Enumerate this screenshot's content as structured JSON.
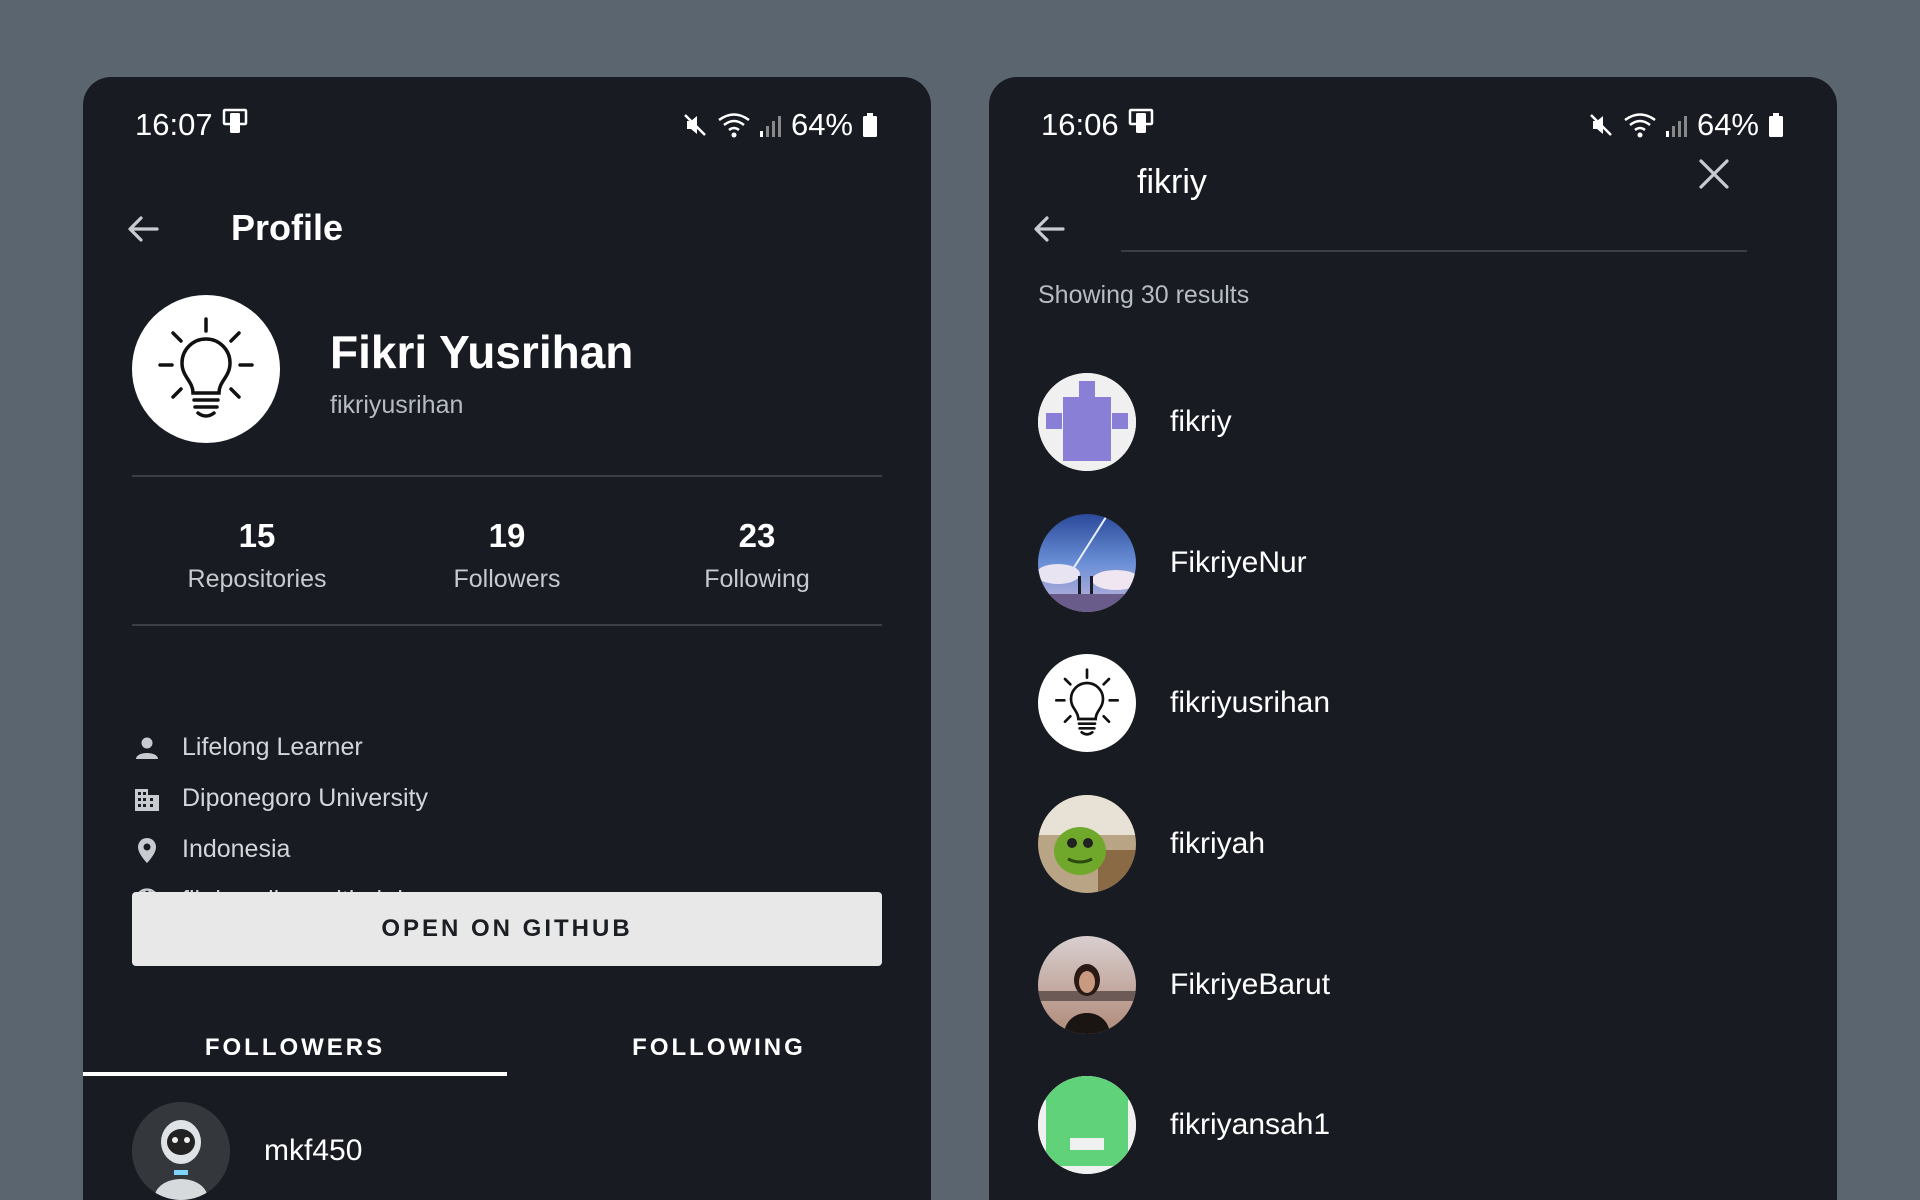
{
  "left_screen": {
    "status": {
      "time": "16:07",
      "battery": "64%"
    },
    "appbar": {
      "title": "Profile"
    },
    "profile": {
      "name": "Fikri Yusrihan",
      "login": "fikriyusrihan",
      "avatar_icon": "lightbulb-icon"
    },
    "stats": [
      {
        "value": "15",
        "label": "Repositories"
      },
      {
        "value": "19",
        "label": "Followers"
      },
      {
        "value": "23",
        "label": "Following"
      }
    ],
    "info": [
      {
        "icon": "person-icon",
        "text": "Lifelong Learner"
      },
      {
        "icon": "building-icon",
        "text": "Diponegoro University"
      },
      {
        "icon": "location-pin-icon",
        "text": "Indonesia"
      },
      {
        "icon": "globe-icon",
        "text": "fikriyusrihan.github.io"
      }
    ],
    "button_label": "OPEN ON GITHUB",
    "tabs": [
      {
        "label": "FOLLOWERS",
        "selected": true
      },
      {
        "label": "FOLLOWING",
        "selected": false
      }
    ],
    "followers": [
      {
        "name": "mkf450"
      }
    ]
  },
  "right_screen": {
    "status": {
      "time": "16:06",
      "battery": "64%"
    },
    "search": {
      "query": "fikriy"
    },
    "results_text": "Showing 30 results",
    "results": [
      {
        "name": "fikriy",
        "avatar": "identicon-purple"
      },
      {
        "name": "FikriyeNur",
        "avatar": "photo-sky"
      },
      {
        "name": "fikriyusrihan",
        "avatar": "lightbulb-icon"
      },
      {
        "name": "fikriyah",
        "avatar": "photo-green-character"
      },
      {
        "name": "FikriyeBarut",
        "avatar": "photo-person"
      },
      {
        "name": "fikriyansah1",
        "avatar": "identicon-green"
      }
    ]
  },
  "colors": {
    "background": "#5b6570",
    "surface": "#181c22",
    "button": "#e8e8e8",
    "identicon_purple": "#8a7fd6",
    "identicon_green": "#5fd27a"
  }
}
